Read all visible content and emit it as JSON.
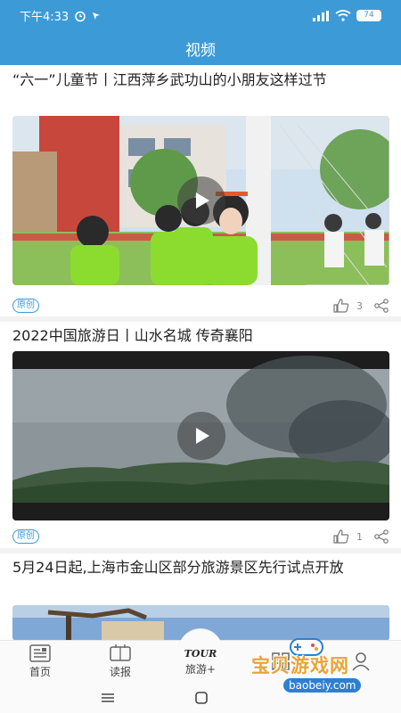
{
  "status": {
    "time": "下午4:33",
    "battery": "74",
    "icons": [
      "alarm-icon",
      "location-arrow-icon",
      "signal-icon",
      "wifi-icon",
      "battery-icon"
    ]
  },
  "header": {
    "title": "视频"
  },
  "feed": {
    "items": [
      {
        "title": "“六一”儿童节丨江西萍乡武功山的小朋友这样过节",
        "tag": "原创",
        "likes": "3"
      },
      {
        "title": "2022中国旅游日丨山水名城 传奇襄阳",
        "tag": "原创",
        "likes": "1"
      },
      {
        "title": "5月24日起,上海市金山区部分旅游景区先行试点开放"
      }
    ]
  },
  "bottom_nav": {
    "items": [
      {
        "label": "首页",
        "icon": "newspaper-icon"
      },
      {
        "label": "读报",
        "icon": "reader-icon"
      },
      {
        "label": "旅游+",
        "icon": "tour-logo-icon",
        "badge": "TOUR"
      },
      {
        "label": "",
        "icon": "grid-icon"
      },
      {
        "label": "",
        "icon": "user-icon"
      }
    ]
  },
  "watermark": {
    "text": "宝贝游戏网",
    "url": "baobeiy.com"
  }
}
